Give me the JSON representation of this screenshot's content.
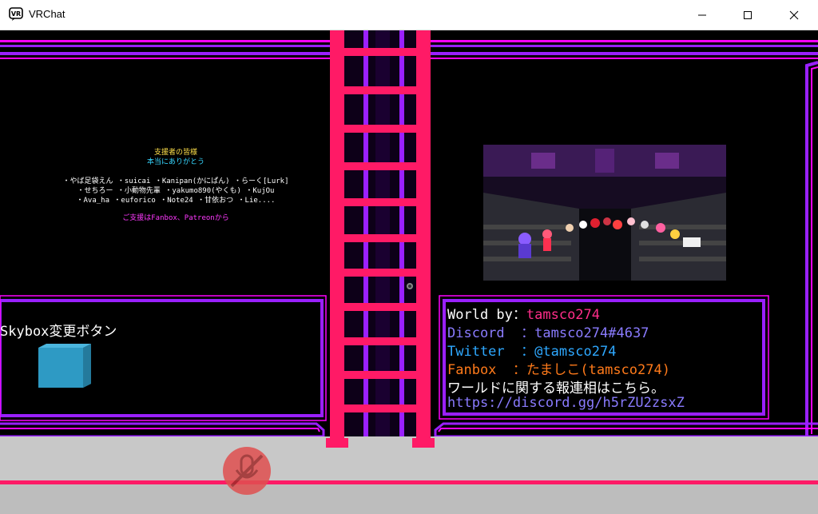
{
  "window": {
    "app_icon_text": "VR",
    "title": "VRChat",
    "controls": [
      "minimize",
      "maximize",
      "close"
    ]
  },
  "supporters": {
    "title": "支援者の皆様",
    "subtitle": "本当にありがとう",
    "lines": [
      "・やば足袋えん ・suicai ・Kanipan(かにぱん) ・らーく[Lurk]",
      "・せちろー ・小動物先輩 ・yakumo890(やくも) ・KujOu",
      "・Ava_ha ・euforico ・Note24 ・甘依おつ ・Lie...."
    ],
    "note": "ご支援はFanbox、Patreonから"
  },
  "skybox": {
    "label": "Skybox変更ボタン",
    "button_color": "#2e9ac4"
  },
  "world_info": {
    "lines": [
      {
        "label": "World by：",
        "value": "tamsco274",
        "label_color": "#ffffff",
        "value_color": "#ff2d8a"
      },
      {
        "label": "Discord  ：",
        "value": "tamsco274#4637",
        "label_color": "#8a7bff",
        "value_color": "#8a7bff"
      },
      {
        "label": "Twitter  ：",
        "value": "@tamsco274",
        "label_color": "#2ea8ff",
        "value_color": "#2ea8ff"
      },
      {
        "label": "Fanbox  ：",
        "value": "たましこ(tamsco274)",
        "label_color": "#ff7a1a",
        "value_color": "#ff7a1a"
      }
    ],
    "contact_text": "ワールドに関する報連相はこちら。",
    "discord_url": "https://discord.gg/h5rZU2zsxZ",
    "url_color": "#8a7bff"
  },
  "colors": {
    "neon_purple": "#9a20ff",
    "neon_magenta": "#ff00ff",
    "ladder": "#ff1a66",
    "floor": "#c8c8c8",
    "floor_stripe": "#ff1a66"
  },
  "icons": {
    "mic_muted": "microphone-muted-icon"
  }
}
